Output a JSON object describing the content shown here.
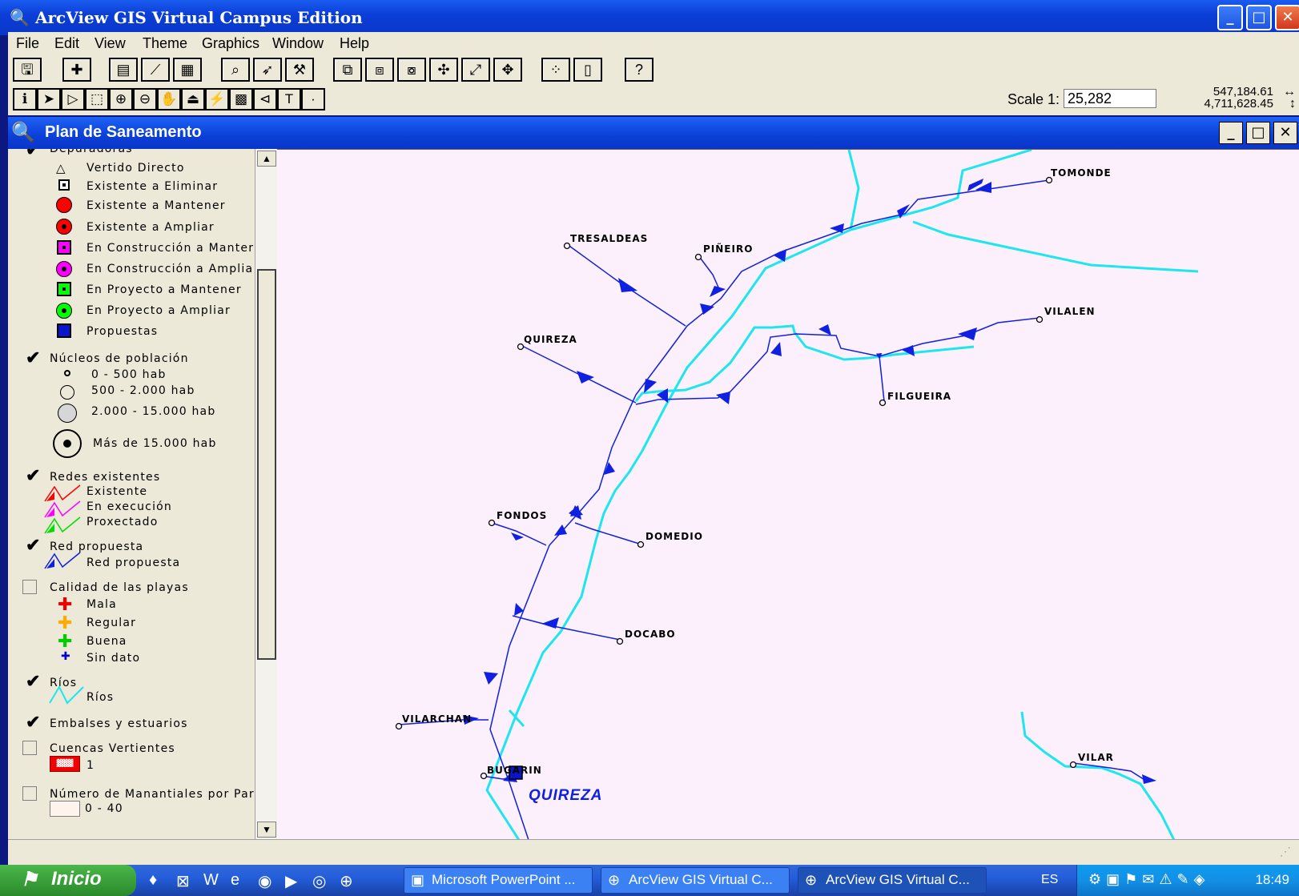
{
  "window": {
    "title": "ArcView GIS Virtual Campus Edition"
  },
  "menu": [
    "File",
    "Edit",
    "View",
    "Theme",
    "Graphics",
    "Window",
    "Help"
  ],
  "scale": {
    "label": "Scale 1:",
    "value": "25,282"
  },
  "coords": {
    "x": "547,184.61",
    "y": "4,711,628.45"
  },
  "document": {
    "title": "Plan de Saneamento"
  },
  "legend": {
    "depuradoras_header": "Depuradoras",
    "depuradoras": [
      "Vertido Directo",
      "Existente a Eliminar",
      "Existente a Mantener",
      "Existente a Ampliar",
      "En Construcción a Manter",
      "En Construcción a Amplia",
      "En Proyecto a Mantener",
      "En Proyecto a Ampliar",
      "Propuestas"
    ],
    "nucleos_header": "Núcleos de población",
    "nucleos": [
      "0 - 500 hab",
      "500 - 2.000 hab",
      "2.000 - 15.000 hab",
      "Más de 15.000 hab"
    ],
    "redes_header": "Redes existentes",
    "redes": [
      "Existente",
      "En execución",
      "Proxectado"
    ],
    "red_propuesta_header": "Red propuesta",
    "red_propuesta": "Red propuesta",
    "calidad_header": "Calidad de las playas",
    "calidad": [
      "Mala",
      "Regular",
      "Buena",
      "Sin dato"
    ],
    "rios_header": "Ríos",
    "rios": "Ríos",
    "embalses_header": "Embalses y estuarios",
    "cuencas_header": "Cuencas Vertientes",
    "cuencas_value": "1",
    "manantiales_header": "Número de Manantiales por Par",
    "manantiales_value": "0 - 40"
  },
  "map": {
    "places": [
      "TOMONDE",
      "TRESALDEAS",
      "PIÑEIRO",
      "VILALEN",
      "QUIREZA",
      "FILGUEIRA",
      "FONDOS",
      "DOMEDIO",
      "DOCABO",
      "VILARCHAN",
      "BUGARIN",
      "VILAR"
    ],
    "region_label": "QUIREZA"
  },
  "taskbar": {
    "start": "Inicio",
    "tasks": [
      "Microsoft PowerPoint ...",
      "ArcView GIS Virtual C...",
      "ArcView GIS Virtual C..."
    ],
    "lang": "ES",
    "clock": "18:49"
  },
  "colors": {
    "river": "#1ee6f0",
    "network": "#1020e0",
    "map_bg": "#fbf0fc"
  }
}
